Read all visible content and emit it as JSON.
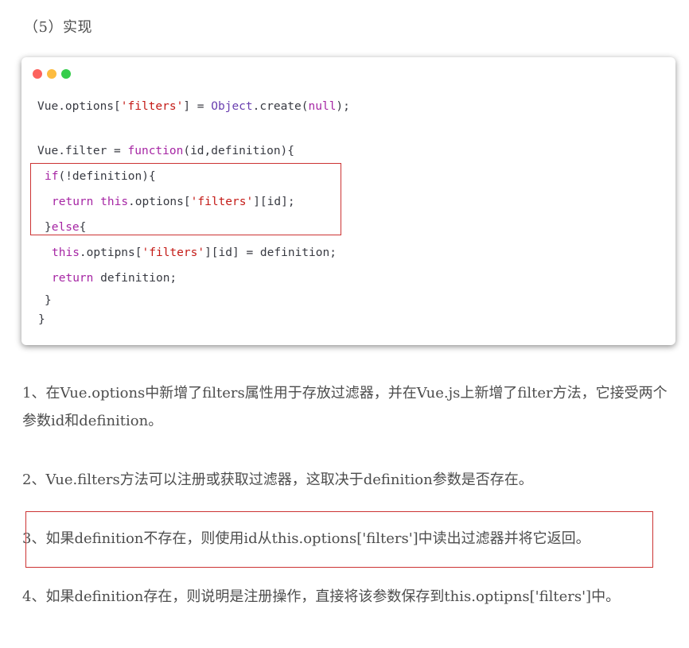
{
  "heading": "（5）实现",
  "code": {
    "l1": {
      "a": "Vue.options[",
      "b": "'filters'",
      "c": "] = ",
      "d": "Object",
      "e": ".create(",
      "f": "null",
      "g": ");"
    },
    "l2": {
      "a": "Vue.filter = ",
      "b": "function",
      "c": "(id,definition){"
    },
    "l3": {
      "a": "if",
      "b": "(!definition){"
    },
    "l4": {
      "a": "return",
      "b": " ",
      "c": "this",
      "d": ".options[",
      "e": "'filters'",
      "f": "][id];"
    },
    "l5": {
      "a": "}",
      "b": "else",
      "c": "{"
    },
    "l6": {
      "a": "this",
      "b": ".optipns[",
      "c": "'filters'",
      "d": "][id] = definition;"
    },
    "l7": {
      "a": "return",
      "b": " definition;"
    },
    "l8": "}",
    "l9": "}"
  },
  "paragraphs": {
    "p1": "1、在Vue.options中新增了filters属性用于存放过滤器，并在Vue.js上新增了filter方法，它接受两个参数id和definition。",
    "p2": "2、Vue.filters方法可以注册或获取过滤器，这取决于definition参数是否存在。",
    "p3": "3、如果definition不存在，则使用id从this.options['filters']中读出过滤器并将它返回。",
    "p4": "4、如果definition存在，则说明是注册操作，直接将该参数保存到this.optipns['filters']中。"
  },
  "colors": {
    "keyword": "#a626a4",
    "string": "#c41a16",
    "builtin": "#6a3fb0",
    "highlight_box": "#cc3333"
  }
}
